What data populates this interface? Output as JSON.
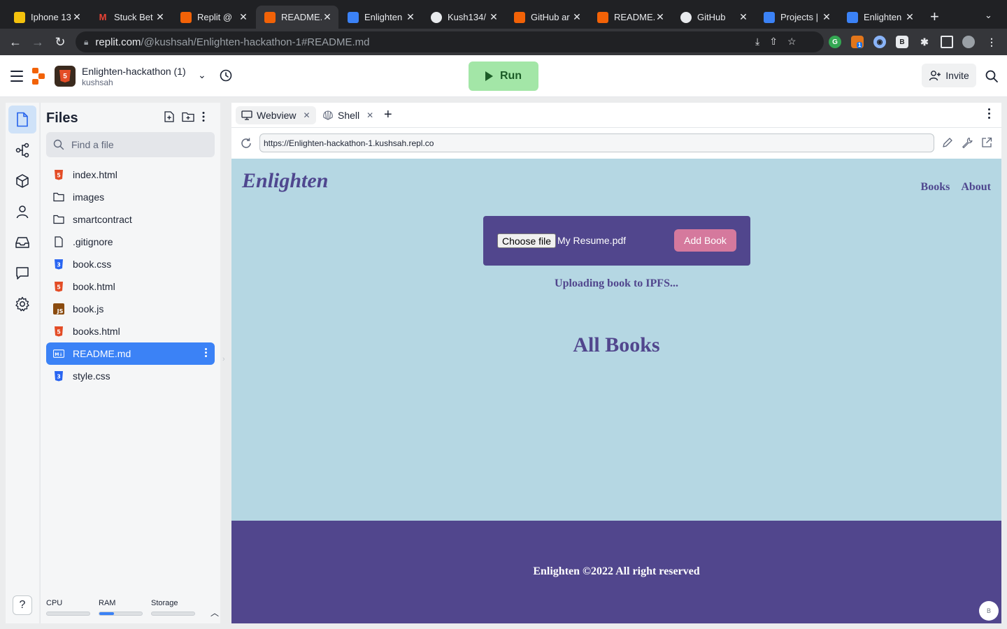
{
  "browser": {
    "tabs": [
      {
        "title": "Iphone 13",
        "fav": "yellow-app-icon",
        "color": "#f4c20d"
      },
      {
        "title": "Stuck Bet",
        "fav": "gmail-icon",
        "color": "#ea4335"
      },
      {
        "title": "Replit @ ",
        "fav": "replit-icon",
        "color": "#f26207"
      },
      {
        "title": "README.",
        "fav": "replit-icon",
        "color": "#f26207"
      },
      {
        "title": "Enlighten",
        "fav": "blue-doc-icon",
        "color": "#3b82f6"
      },
      {
        "title": "Kush134/",
        "fav": "github-icon",
        "color": "#ffffff"
      },
      {
        "title": "GitHub ar",
        "fav": "replit-icon",
        "color": "#f26207"
      },
      {
        "title": "README.",
        "fav": "replit-icon",
        "color": "#f26207"
      },
      {
        "title": "GitHub",
        "fav": "github-icon",
        "color": "#ffffff"
      },
      {
        "title": "Projects |",
        "fav": "blue-doc-icon",
        "color": "#3b82f6"
      },
      {
        "title": "Enlighten",
        "fav": "blue-doc-icon",
        "color": "#3b82f6"
      }
    ],
    "url_host": "replit.com",
    "url_path": "/@kushsah/Enlighten-hackathon-1#README.md",
    "ext_badge": "1"
  },
  "header": {
    "project_name": "Enlighten-hackathon (1)",
    "owner": "kushsah",
    "run_label": "Run",
    "invite_label": "Invite"
  },
  "files_panel": {
    "title": "Files",
    "search_placeholder": "Find a file",
    "items": [
      {
        "name": "index.html",
        "type": "html"
      },
      {
        "name": "images",
        "type": "folder"
      },
      {
        "name": "smartcontract",
        "type": "folder"
      },
      {
        "name": ".gitignore",
        "type": "file"
      },
      {
        "name": "book.css",
        "type": "css"
      },
      {
        "name": "book.html",
        "type": "html"
      },
      {
        "name": "book.js",
        "type": "js"
      },
      {
        "name": "books.html",
        "type": "html"
      },
      {
        "name": "README.md",
        "type": "md",
        "selected": true
      },
      {
        "name": "style.css",
        "type": "css"
      }
    ],
    "resources": {
      "cpu_label": "CPU",
      "cpu_fill": 0,
      "ram_label": "RAM",
      "ram_fill": 0.35,
      "storage_label": "Storage",
      "storage_fill": 0
    }
  },
  "pane": {
    "tabs": [
      {
        "label": "Webview",
        "icon": "monitor-icon",
        "active": true
      },
      {
        "label": "Shell",
        "icon": "shell-icon",
        "active": false
      }
    ],
    "webview_url": "https://Enlighten-hackathon-1.kushsah.repl.co"
  },
  "webview": {
    "brand": "Enlighten",
    "nav": [
      "Books",
      "About"
    ],
    "choose_file_label": "Choose file",
    "chosen_file": "My Resume.pdf",
    "add_book_label": "Add Book",
    "status": "Uploading book to IPFS...",
    "heading": "All Books",
    "footer": "Enlighten ©2022 All right reserved",
    "badge": "B"
  },
  "colors": {
    "accent_blue": "#3b82f6",
    "run_green": "#a3e6a7",
    "site_bg": "#b5d7e3",
    "site_purple": "#51468d",
    "add_book_pink": "#d5799d"
  }
}
